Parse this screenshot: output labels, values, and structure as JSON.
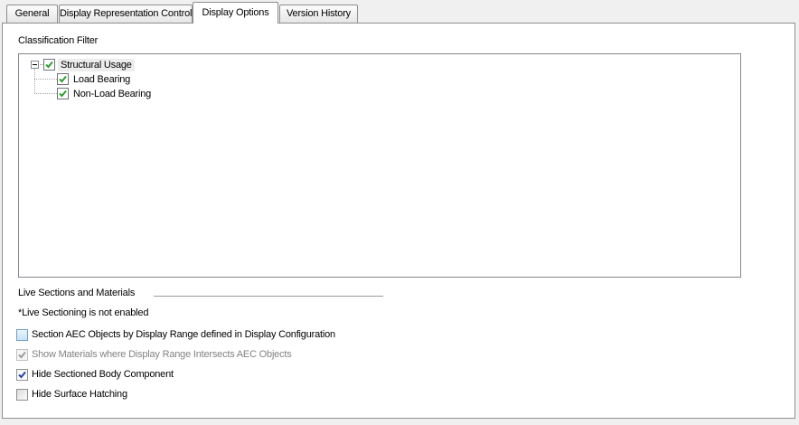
{
  "tabs": [
    {
      "label": "General",
      "active": false
    },
    {
      "label": "Display Representation Control",
      "active": false
    },
    {
      "label": "Display Options",
      "active": true
    },
    {
      "label": "Version History",
      "active": false
    }
  ],
  "classification_filter": {
    "title": "Classification Filter",
    "tree": [
      {
        "label": "Structural Usage",
        "level": 0,
        "checked": true,
        "expanded": true,
        "selected": true
      },
      {
        "label": "Load Bearing",
        "level": 1,
        "checked": true
      },
      {
        "label": "Non-Load Bearing",
        "level": 1,
        "checked": true
      }
    ]
  },
  "live_sections": {
    "title": "Live Sections and Materials",
    "status_note": "*Live Sectioning is not enabled",
    "options": [
      {
        "label": "Section AEC Objects by Display Range defined in Display Configuration",
        "checked": false,
        "enabled": true,
        "hovered": true
      },
      {
        "label": "Show Materials where Display Range Intersects AEC Objects",
        "checked": true,
        "enabled": false
      },
      {
        "label": "Hide Sectioned Body Component",
        "checked": true,
        "enabled": true
      },
      {
        "label": "Hide Surface Hatching",
        "checked": false,
        "enabled": true
      }
    ]
  },
  "colors": {
    "dialog_bg": "#f0f0f0",
    "page_bg": "#ffffff",
    "border_gray": "#8c8e91",
    "tree_check_green": "#2da02d",
    "check_blue": "#2342a3",
    "disabled_text": "#838383",
    "hover_checkbox_fill": "#c9e2f5",
    "selection_bg": "#ececec"
  }
}
